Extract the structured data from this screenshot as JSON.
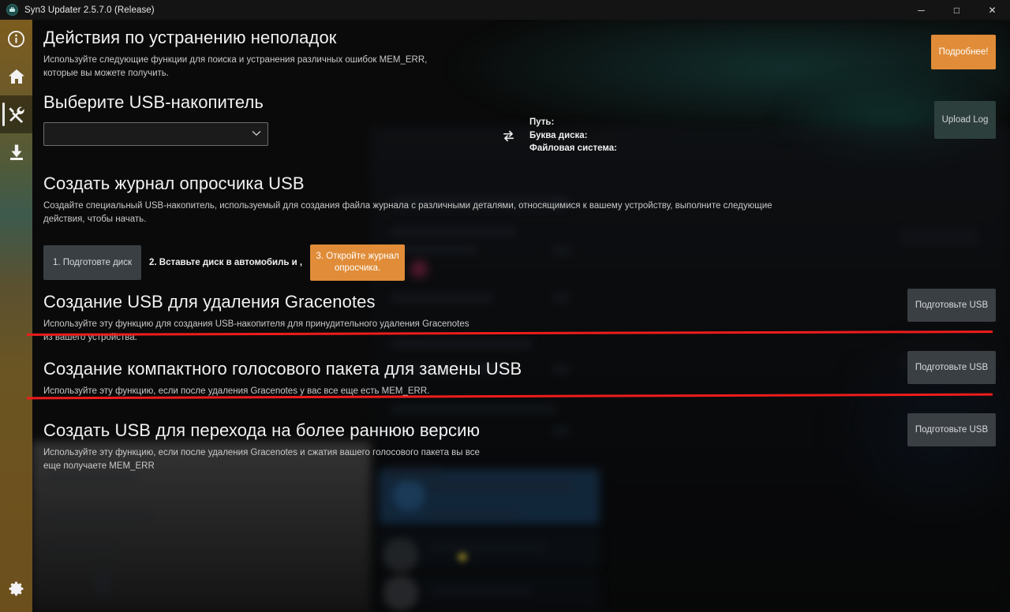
{
  "window": {
    "title": "Syn3 Updater 2.5.7.0 (Release)",
    "icon": "app-icon",
    "controls": {
      "minimize": "─",
      "maximize": "□",
      "close": "✕"
    }
  },
  "sidebar": {
    "items": [
      {
        "name": "info",
        "icon": "info-icon",
        "active": false
      },
      {
        "name": "home",
        "icon": "home-icon",
        "active": false
      },
      {
        "name": "utilities",
        "icon": "tools-icon",
        "active": true
      },
      {
        "name": "downloads",
        "icon": "download-icon",
        "active": false
      }
    ],
    "bottom": {
      "name": "settings",
      "icon": "gear-icon"
    }
  },
  "header": {
    "title": "Действия по устранению неполадок",
    "description": "Используйте следующие функции для поиска и устранения различных ошибок MEM_ERR, которые вы можете получить.",
    "more_button": "Подробнее!"
  },
  "usb_select": {
    "title": "Выберите USB-накопитель",
    "selected_value": "",
    "chevron": "∨",
    "refresh_icon": "refresh-icon",
    "info": {
      "path_label": "Путь:",
      "drive_letter_label": "Буква диска:",
      "file_system_label": "Файловая система:",
      "path_value": "",
      "drive_letter_value": "",
      "file_system_value": ""
    },
    "upload_log_button": "Upload Log"
  },
  "sections": {
    "logger": {
      "title": "Создать журнал опросчика USB",
      "description": "Создайте специальный USB-накопитель, используемый для создания файла журнала с различными деталями, относящимися к вашему устройству, выполните следующие действия, чтобы начать.",
      "step1_button": "1. Подготовте диск",
      "step2_text": "2. Вставьте диск в автомобиль и ,",
      "step3_button": "3. Откройте журнал опросчика."
    },
    "gracenotes": {
      "title": "Создание USB для удаления Gracenotes",
      "description": "Используйте эту функцию для создания USB-накопителя для принудительного удаления Gracenotes из вашего устройства.",
      "button": "Подготовьте USB"
    },
    "voice_package": {
      "title": "Создание компактного голосового пакета для замены USB",
      "description": "Используйте эту функцию, если после удаления Gracenotes у вас все еще есть MEM_ERR.",
      "button": "Подготовьте USB"
    },
    "downgrade": {
      "title": "Создать USB для перехода на более раннюю версию",
      "description": "Используйте эту функцию, если после удаления Gracenotes и сжатия вашего голосового пакета вы все еще получаете MEM_ERR",
      "button": "Подготовьте USB"
    }
  },
  "annotations": {
    "line_color": "#ee1c1c",
    "count": 2
  },
  "colors": {
    "accent_orange": "#e08c38",
    "sidebar_gold": "#6b4f1c",
    "background": "#0a0a0a",
    "titlebar": "#141414",
    "button_grey": "#3a3f44",
    "button_teal": "#2d3f3d"
  }
}
